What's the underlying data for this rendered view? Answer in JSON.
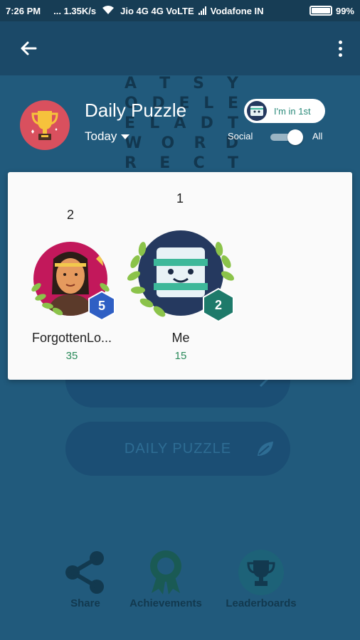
{
  "status_bar": {
    "time": "7:26 PM",
    "speed": "... 1.35K/s",
    "sim1": "Jio 4G 4G VoLTE",
    "sim2": "Vodafone IN",
    "battery": "99%"
  },
  "background_letters": [
    [
      "A",
      "T",
      "S",
      "Y"
    ],
    [
      "O",
      "D",
      "E",
      "L",
      "E"
    ],
    [
      "E",
      "L",
      "A",
      "D",
      "T"
    ],
    [
      "W",
      "O",
      "R",
      "D"
    ],
    [
      "R",
      "E",
      "C",
      "T"
    ]
  ],
  "header": {
    "title": "Daily Puzzle",
    "date_filter": "Today",
    "rank_pill": "I'm in 1st",
    "toggle_left": "Social",
    "toggle_right": "All",
    "toggle_on": true
  },
  "podium": {
    "players": [
      {
        "rank": "2",
        "name": "ForgottenLo...",
        "score": "35",
        "level": "5"
      },
      {
        "rank": "1",
        "name": "Me",
        "score": "15",
        "level": "2"
      }
    ]
  },
  "background_buttons": {
    "daily_puzzle": "DAILY PUZZLE"
  },
  "bottom_nav": {
    "share": "Share",
    "achievements": "Achievements",
    "leaderboards": "Leaderboards"
  },
  "colors": {
    "background": "#215a7c",
    "app_bar": "#1b4968",
    "accent_green": "#2a8a5a",
    "level_badge_blue": "#2f5fc4",
    "level_badge_teal": "#1e7a6a"
  }
}
